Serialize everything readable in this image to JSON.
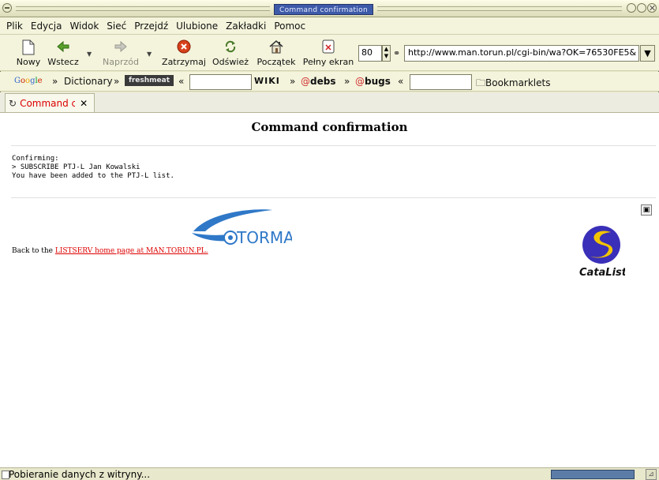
{
  "window": {
    "title": "Command confirmation"
  },
  "menubar": {
    "items": [
      "Plik",
      "Edycja",
      "Widok",
      "Sieć",
      "Przejdź",
      "Ulubione",
      "Zakładki",
      "Pomoc"
    ]
  },
  "toolbar": {
    "new_label": "Nowy",
    "back_label": "Wstecz",
    "forward_label": "Naprzód",
    "stop_label": "Zatrzymaj",
    "reload_label": "Odśwież",
    "home_label": "Początek",
    "fullscreen_label": "Pełny ekran",
    "zoom_value": "80",
    "url": "http://www.man.torun.pl/cgi-bin/wa?OK=76530FE5&"
  },
  "bookmarks": {
    "google_label": "Google GROUPS",
    "dictionary_label": "Dictionary",
    "freshmeat_label": "freshmeat",
    "wiki_label": "WIKI",
    "debs_label": "debs",
    "bugs_label": "bugs",
    "bookmarklets_label": "Bookmarklets",
    "separator_right": "»",
    "separator_left": "«"
  },
  "tab": {
    "label": "Command co"
  },
  "page": {
    "heading": "Command confirmation",
    "confirm_lines": "Confirming:\n> SUBSCRIBE PTJ-L Jan Kowalski\nYou have been added to the PTJ-L list.",
    "back_prefix": "Back to the ",
    "back_link": "LISTSERV home page at MAN.TORUN.PL.",
    "torman_text": "TORMAN",
    "catalist_text": "CataList"
  },
  "status": {
    "text": "Pobieranie danych z witryny..."
  },
  "colors": {
    "link": "#d00000",
    "title_bar": "#3d5aa8",
    "torman_blue": "#2f78c8",
    "catalist_purple": "#3a2fb8",
    "catalist_yellow": "#f2c400"
  }
}
